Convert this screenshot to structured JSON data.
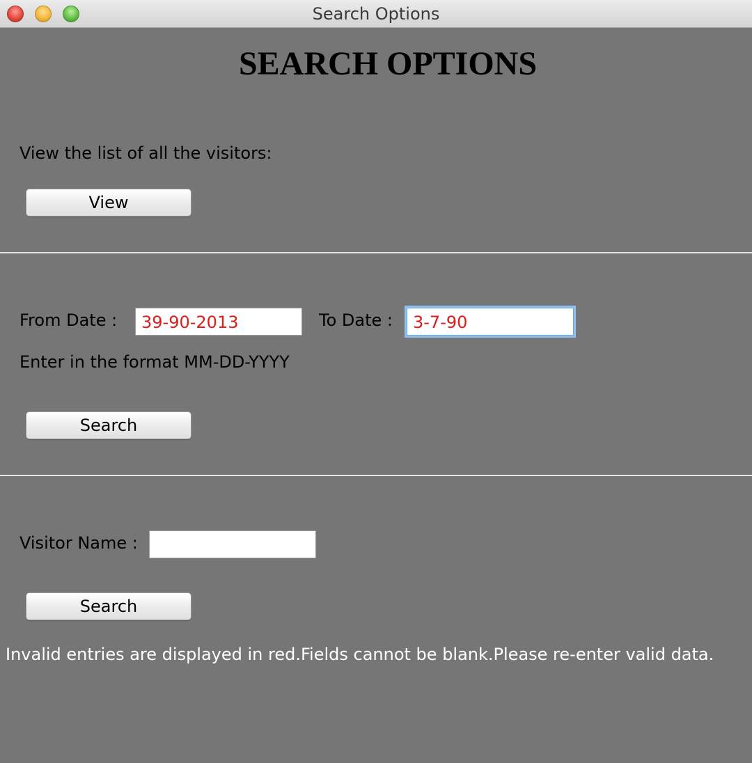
{
  "window": {
    "title": "Search Options"
  },
  "heading": "SEARCH OPTIONS",
  "view_section": {
    "label": "View the list of all the visitors:",
    "button_label": "View"
  },
  "date_section": {
    "from_label": "From Date :",
    "from_value": "39-90-2013",
    "to_label": "To Date :",
    "to_value": "3-7-90",
    "format_hint": "Enter in the format MM-DD-YYYY",
    "button_label": "Search"
  },
  "name_section": {
    "label": "Visitor Name :",
    "value": "",
    "button_label": "Search"
  },
  "error_message": "Invalid entries are displayed in red.Fields cannot be blank.Please re-enter valid data.",
  "colors": {
    "background": "#767676",
    "invalid_text": "#e01b1b",
    "message_text": "#ffffff"
  }
}
